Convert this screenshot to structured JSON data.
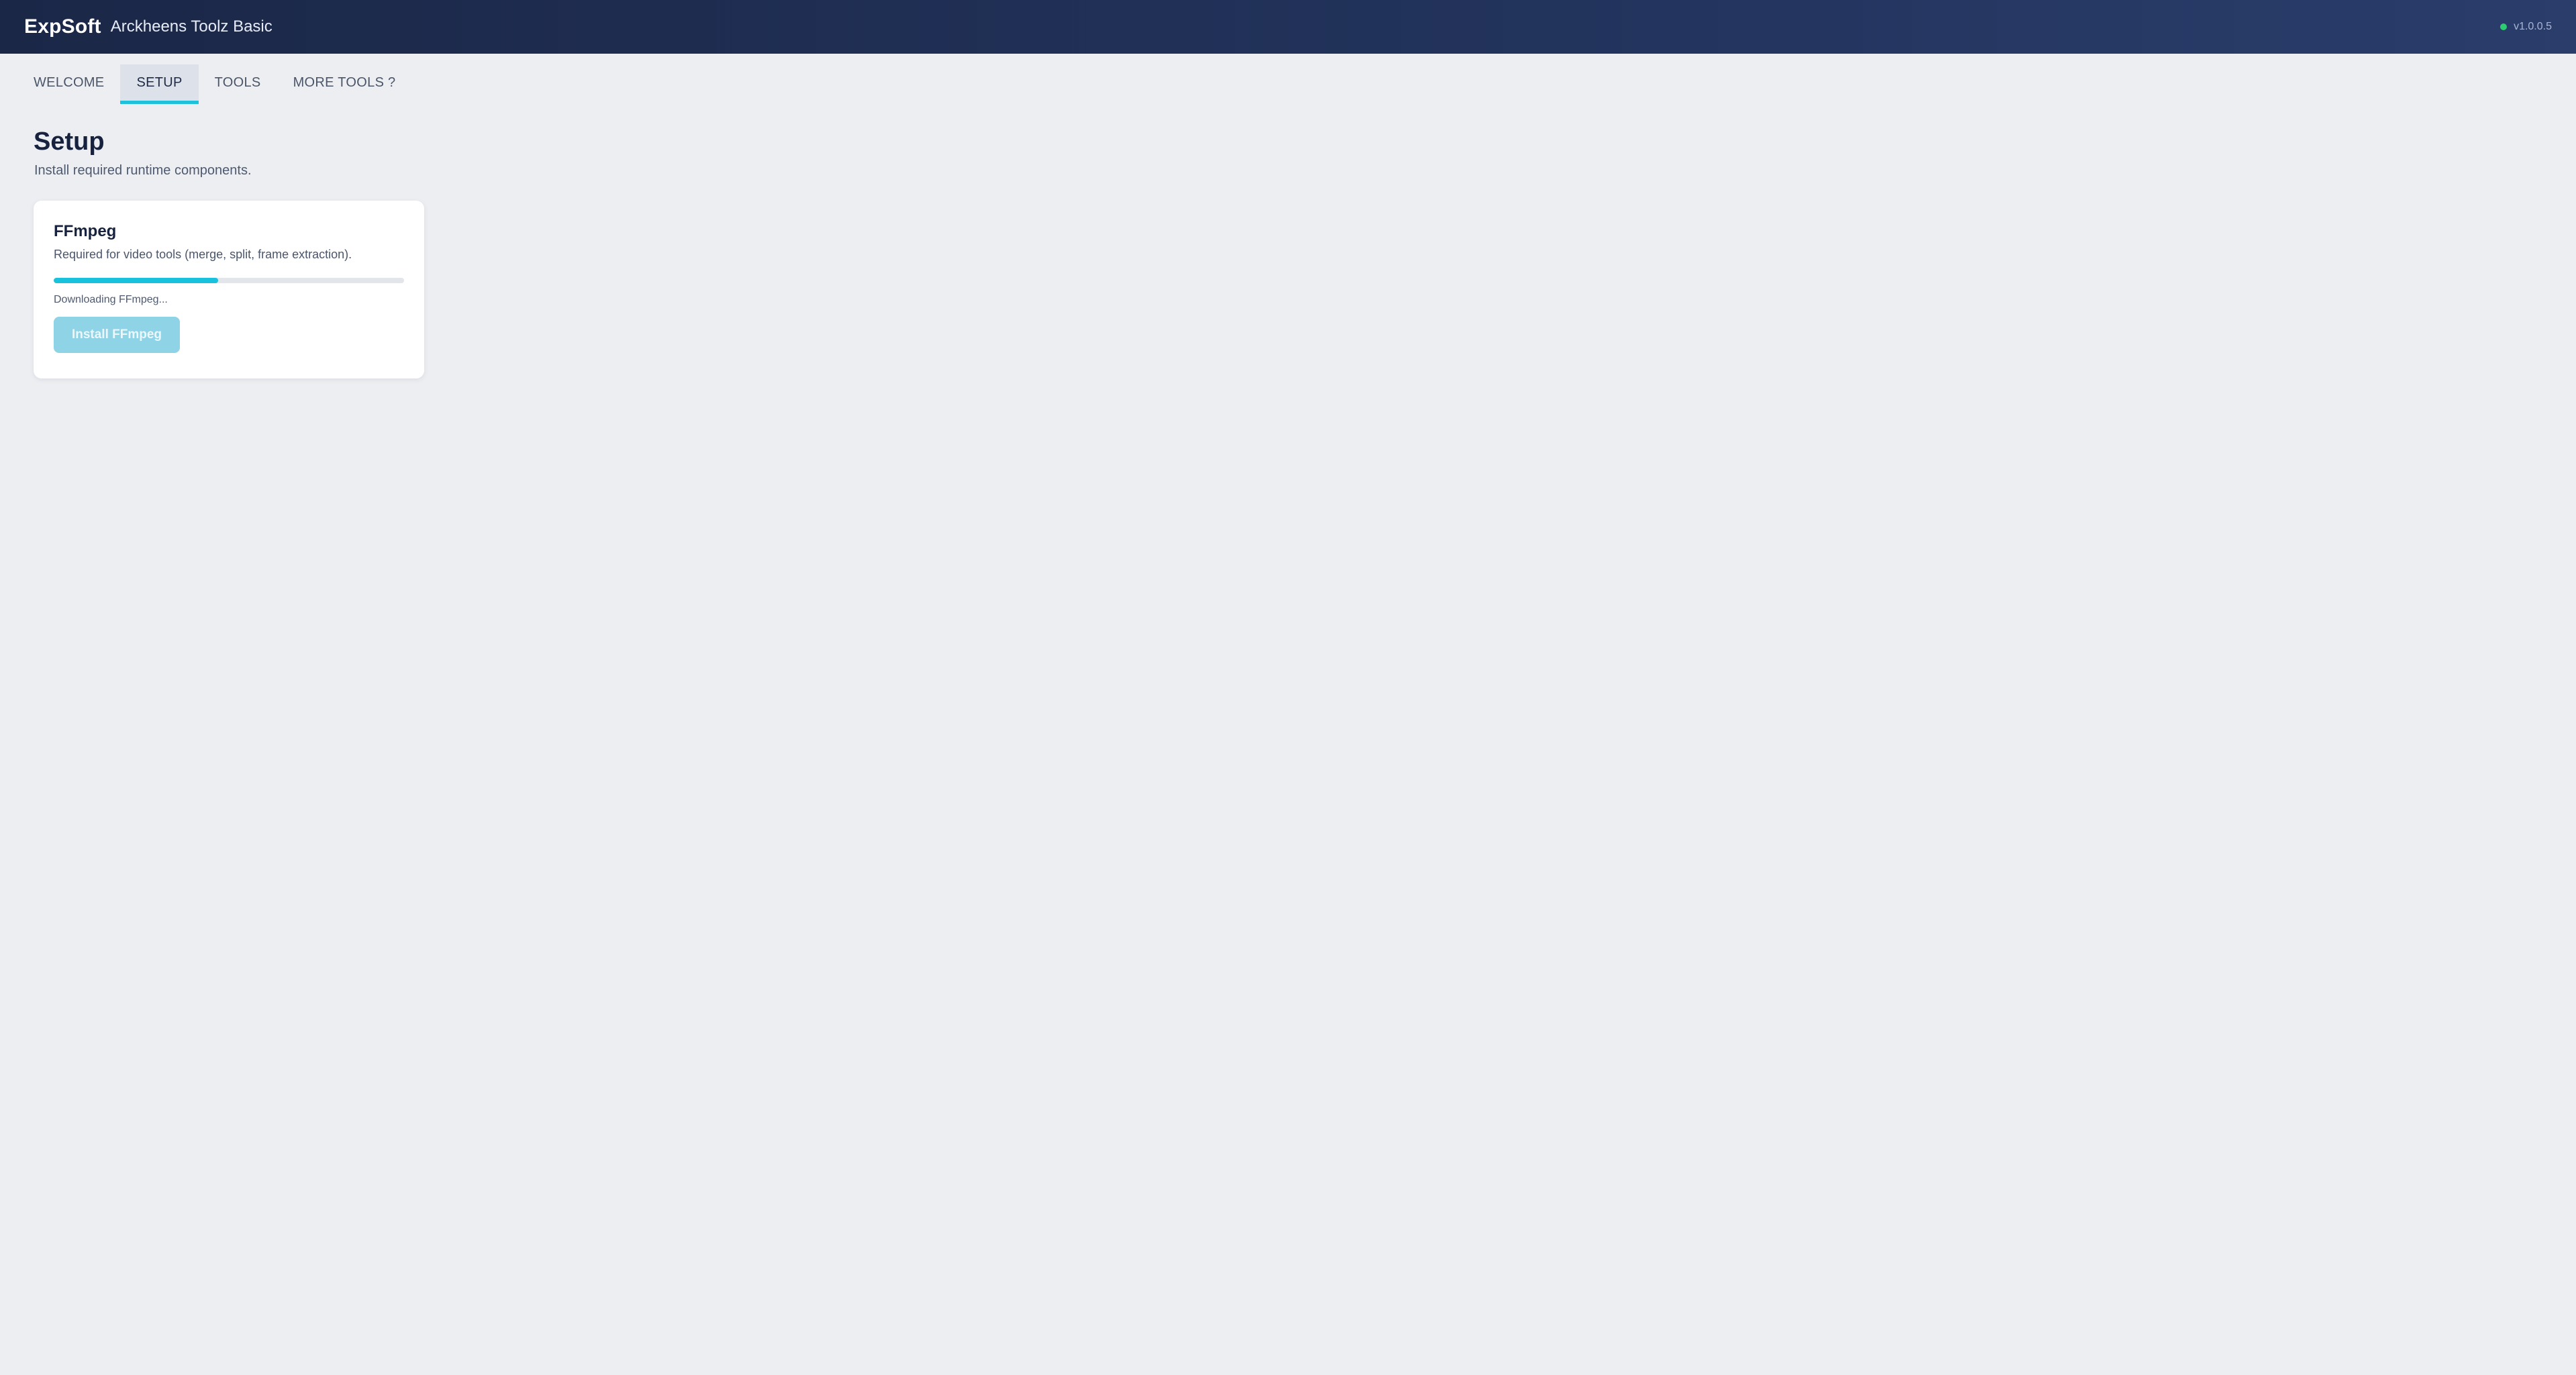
{
  "header": {
    "brand": "ExpSoft",
    "title": "Arckheens Toolz Basic",
    "version": "v1.0.0.5",
    "status_color": "#2ecc71"
  },
  "tabs": [
    {
      "label": "WELCOME",
      "active": false
    },
    {
      "label": "SETUP",
      "active": true
    },
    {
      "label": "TOOLS",
      "active": false
    },
    {
      "label": "MORE TOOLS ?",
      "active": false
    }
  ],
  "page": {
    "title": "Setup",
    "subtitle": "Install required runtime components."
  },
  "component": {
    "name": "FFmpeg",
    "description": "Required for video tools (merge, split, frame extraction).",
    "progress": 0.47,
    "status": "Downloading FFmpeg...",
    "button_label": "Install FFmpeg",
    "button_disabled": true
  },
  "colors": {
    "accent": "#1fc1da",
    "header_bg": "#1b2747",
    "page_bg": "#eceef2"
  }
}
